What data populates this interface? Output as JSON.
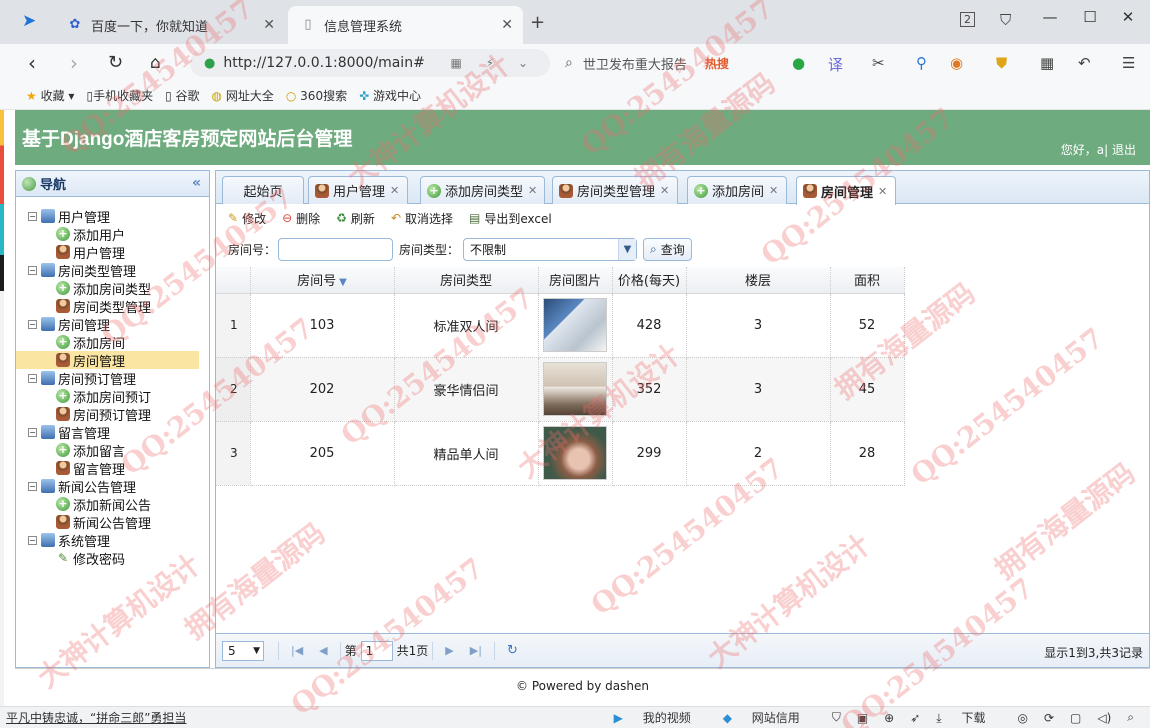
{
  "browser": {
    "tabs": [
      {
        "label": "百度一下，你就知道",
        "icon": "baidu-paw-icon"
      },
      {
        "label": "信息管理系统",
        "icon": "page-icon",
        "active": true
      }
    ],
    "tab_counter": "2",
    "url": "http://127.0.0.1:8000/main#",
    "search_hint": "世卫发布重大报告",
    "search_hot": "热搜",
    "bookmarks": [
      "收藏",
      "手机收藏夹",
      "谷歌",
      "网址大全",
      "360搜索",
      "游戏中心"
    ]
  },
  "app": {
    "title": "基于Django酒店客房预定网站后台管理",
    "greeting": "您好，a| 退出"
  },
  "sidebar": {
    "title": "导航",
    "groups": [
      {
        "label": "用户管理",
        "items": [
          "添加用户",
          "用户管理"
        ]
      },
      {
        "label": "房间类型管理",
        "items": [
          "添加房间类型",
          "房间类型管理"
        ]
      },
      {
        "label": "房间管理",
        "items": [
          "添加房间",
          "房间管理"
        ]
      },
      {
        "label": "房间预订管理",
        "items": [
          "添加房间预订",
          "房间预订管理"
        ]
      },
      {
        "label": "留言管理",
        "items": [
          "添加留言",
          "留言管理"
        ]
      },
      {
        "label": "新闻公告管理",
        "items": [
          "添加新闻公告",
          "新闻公告管理"
        ]
      },
      {
        "label": "系统管理",
        "items": [
          "修改密码"
        ]
      }
    ],
    "selected": "房间管理"
  },
  "main": {
    "tabs": [
      {
        "label": "起始页",
        "icon": "none"
      },
      {
        "label": "用户管理",
        "icon": "user-icon"
      },
      {
        "label": "添加房间类型",
        "icon": "add-icon"
      },
      {
        "label": "房间类型管理",
        "icon": "user-icon"
      },
      {
        "label": "添加房间",
        "icon": "add-icon"
      },
      {
        "label": "房间管理",
        "icon": "user-icon"
      }
    ],
    "toolbar": {
      "edit": "修改",
      "delete": "删除",
      "refresh": "刷新",
      "deselect": "取消选择",
      "export": "导出到excel"
    },
    "filters": {
      "room_no_label": "房间号：",
      "room_no_value": "",
      "room_type_label": "房间类型：",
      "room_type_value": "不限制",
      "query": "查询"
    },
    "table": {
      "columns": [
        "房间号",
        "房间类型",
        "房间图片",
        "价格(每天)",
        "楼层",
        "面积"
      ],
      "rows": [
        {
          "n": "1",
          "room_no": "103",
          "type": "标准双人间",
          "price": "428",
          "floor": "3",
          "area": "52"
        },
        {
          "n": "2",
          "room_no": "202",
          "type": "豪华情侣间",
          "price": "352",
          "floor": "3",
          "area": "45"
        },
        {
          "n": "3",
          "room_no": "205",
          "type": "精品单人间",
          "price": "299",
          "floor": "2",
          "area": "28"
        }
      ]
    },
    "pager": {
      "page_size": "5",
      "page_prefix": "第",
      "page": "1",
      "page_total": "共1页",
      "info": "显示1到3,共3记录"
    }
  },
  "footer": "© Powered by dashen",
  "statusbar": {
    "news": "平凡中铸忠诚，“拼命三郎”勇担当",
    "items": [
      "我的视频",
      "网站信用",
      "下载"
    ]
  },
  "watermarks": [
    "QQ:254540457",
    "大神计算机设计",
    "拥有海量源码"
  ],
  "colors": {
    "header": "#6eab7e",
    "border": "#9bbad9",
    "selected": "#fbe5a3"
  }
}
